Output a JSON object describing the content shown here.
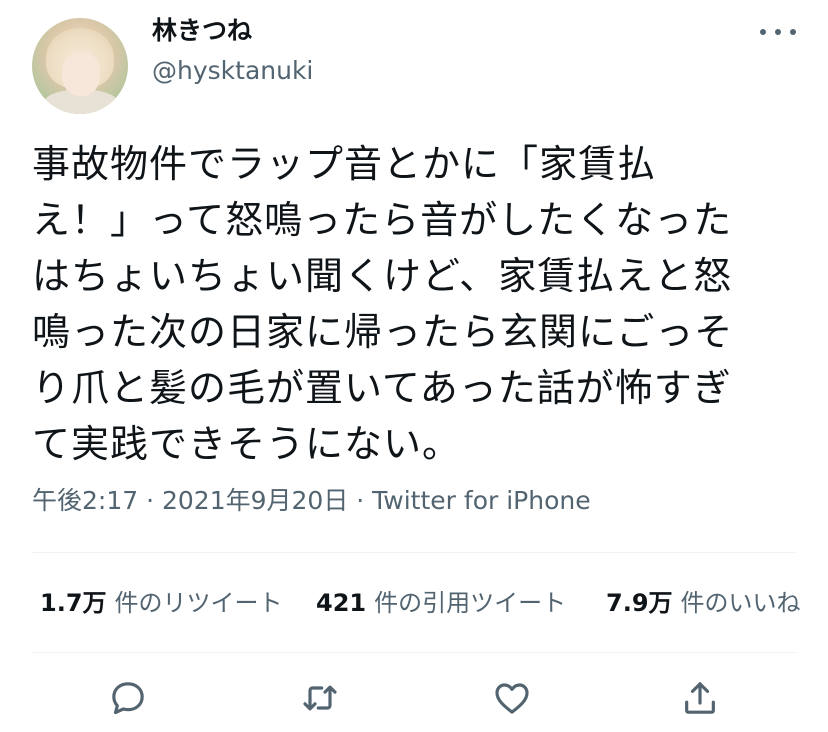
{
  "user": {
    "display_name": "林きつね",
    "handle": "@hysktanuki"
  },
  "tweet": {
    "lines": [
      "事故物件でラップ音とかに「家賃払",
      "え！」って怒鳴ったら音がしたくなった",
      "はちょいちょい聞くけど、家賃払えと怒",
      "鳴った次の日家に帰ったら玄関にごっそ",
      "り爪と髪の毛が置いてあった話が怖すぎ",
      "て実践できそうにない。"
    ],
    "meta": "午後2:17 · 2021年9月20日 · Twitter for iPhone"
  },
  "stats": {
    "retweets": {
      "count": "1.7万",
      "label": "件のリツイート"
    },
    "quotes": {
      "count": "421",
      "label": "件の引用ツイート"
    },
    "likes": {
      "count": "7.9万",
      "label": "件のいいね"
    }
  },
  "actions": {
    "reply_icon": "speech-bubble",
    "retweet_icon": "retweet-arrows",
    "like_icon": "heart",
    "share_icon": "upload-arrow"
  },
  "colors": {
    "text": "#0f1419",
    "secondary": "#536471",
    "divider": "#eff3f4"
  }
}
